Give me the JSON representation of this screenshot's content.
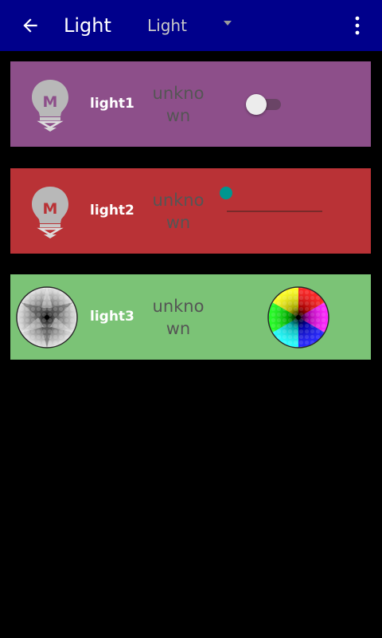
{
  "appbar": {
    "title": "Light",
    "spinner_value": "Light",
    "background_color": "#00008b",
    "back_icon": "arrow-left-icon",
    "overflow_icon": "more-vert-icon"
  },
  "lights": [
    {
      "name": "light1",
      "status": "unknown",
      "control": "switch",
      "switch_on": false,
      "icon": "bulb-m-icon",
      "background_color": "#8d4f8a"
    },
    {
      "name": "light2",
      "status": "unknown",
      "control": "slider",
      "slider_value": 0,
      "icon": "bulb-m-icon",
      "background_color": "#b93236"
    },
    {
      "name": "light3",
      "status": "unknown",
      "control": "color-wheel",
      "icon": "grayscale-wheel-icon",
      "background_color": "#7bc376"
    }
  ]
}
